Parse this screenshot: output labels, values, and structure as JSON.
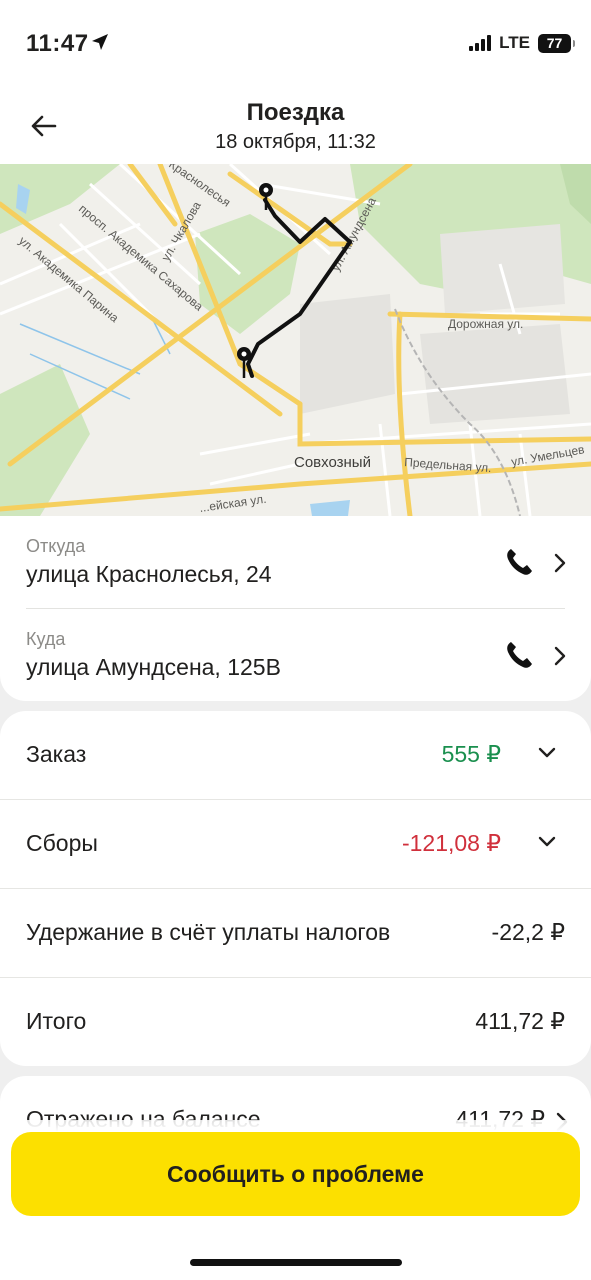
{
  "status_bar": {
    "time": "11:47",
    "network": "LTE",
    "battery": "77"
  },
  "header": {
    "title": "Поездка",
    "subtitle": "18 октября, 11:32"
  },
  "map": {
    "labels": {
      "parina": "ул. Академика Парина",
      "sakharova": "просп. Академика Сахарова",
      "chkalova": "ул. Чкалова",
      "krasnolesya": "Краснолесья",
      "amundsena": "ул. Амундсена",
      "dorozhnaya": "Дорожная ул.",
      "sovkhozny": "Совхозный",
      "predelnaya": "Предельная ул.",
      "umeltsev": "ул. Умельцев",
      "bottom_street": "...ейская ул."
    }
  },
  "route": {
    "from": {
      "label": "Откуда",
      "address": "улица Краснолесья, 24"
    },
    "to": {
      "label": "Куда",
      "address": "улица Амундсена, 125В"
    }
  },
  "payment": {
    "order": {
      "label": "Заказ",
      "value": "555 ₽"
    },
    "fees": {
      "label": "Сборы",
      "value": "-121,08 ₽"
    },
    "tax": {
      "label": "Удержание в счёт уплаты налогов",
      "value": "-22,2 ₽"
    },
    "total": {
      "label": "Итого",
      "value": "411,72 ₽"
    }
  },
  "balance": {
    "label": "Отражено на балансе",
    "value": "411,72 ₽"
  },
  "actions": {
    "report_problem": "Сообщить о проблеме"
  },
  "colors": {
    "accent_yellow": "#fce000",
    "positive": "#1a8f4e",
    "negative": "#d0303c"
  }
}
